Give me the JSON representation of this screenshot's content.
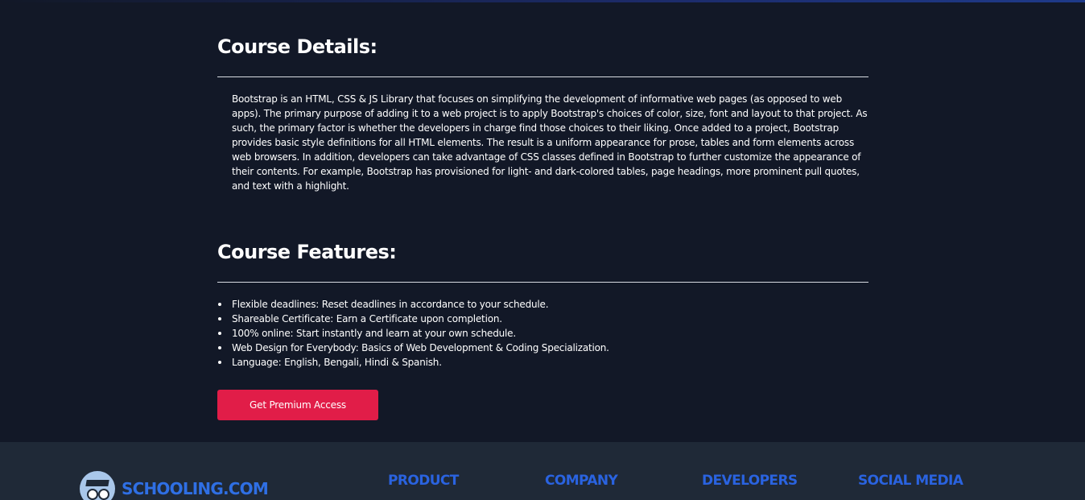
{
  "course_details": {
    "title": "Course Details:",
    "description": "Bootstrap is an HTML, CSS & JS Library that focuses on simplifying the development of informative web pages (as opposed to web apps). The primary purpose of adding it to a web project is to apply Bootstrap's choices of color, size, font and layout to that project. As such, the primary factor is whether the developers in charge find those choices to their liking. Once added to a project, Bootstrap provides basic style definitions for all HTML elements. The result is a uniform appearance for prose, tables and form elements across web browsers. In addition, developers can take advantage of CSS classes defined in Bootstrap to further customize the appearance of their contents. For example, Bootstrap has provisioned for light- and dark-colored tables, page headings, more prominent pull quotes, and text with a highlight."
  },
  "course_features": {
    "title": "Course Features:",
    "items": [
      "Flexible deadlines: Reset deadlines in accordance to your schedule.",
      "Shareable Certificate: Earn a Certificate upon completion.",
      "100% online: Start instantly and learn at your own schedule.",
      "Web Design for Everybody: Basics of Web Development & Coding Specialization.",
      "Language: English, Bengali, Hindi & Spanish."
    ]
  },
  "cta": {
    "label": "Get Premium Access",
    "color": "#e11d48"
  },
  "footer": {
    "brand": "SCHOOLING.COM",
    "logo_icon": "owl-graduate-icon",
    "headings": [
      "PRODUCT",
      "COMPANY",
      "DEVELOPERS",
      "SOCIAL MEDIA"
    ],
    "heading_color": "#2a63e0"
  },
  "colors": {
    "background": "#121827",
    "footer_background": "#1f2937"
  }
}
